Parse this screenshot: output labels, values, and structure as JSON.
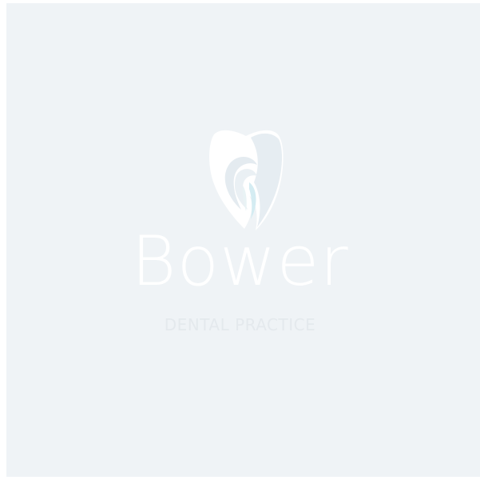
{
  "logo": {
    "icon": "tooth-icon",
    "name": "Bower",
    "tagline": "DENTAL PRACTICE"
  },
  "colors": {
    "background": "#eff3f6",
    "name_text": "#ffffff",
    "tagline_text": "#e4e9ed",
    "tooth_outer": "#ffffff",
    "tooth_inner": "#e2ecf2",
    "tooth_accent": "#cfe8f0"
  }
}
